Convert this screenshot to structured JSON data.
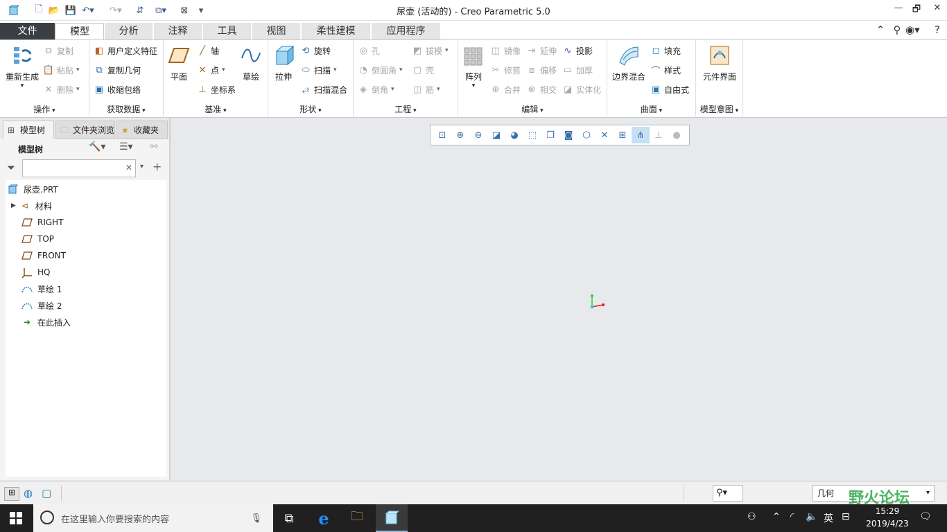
{
  "window": {
    "title": "尿壶 (活动的) - Creo Parametric 5.0",
    "controls": [
      "—",
      "🗗",
      "✕"
    ]
  },
  "tabs": [
    "文件",
    "模型",
    "分析",
    "注释",
    "工具",
    "视图",
    "柔性建模",
    "应用程序"
  ],
  "ribbon": {
    "operations": {
      "label": "操作",
      "regenerate": "重新生成",
      "copy": "复制",
      "paste": "粘贴",
      "delete": "删除"
    },
    "get_data": {
      "label": "获取数据",
      "udf": "用户定义特征",
      "copy_geom": "复制几何",
      "shrinkwrap": "收缩包络"
    },
    "datum": {
      "label": "基准",
      "plane": "平面",
      "axis": "轴",
      "point": "点",
      "csys": "坐标系",
      "sketch": "草绘"
    },
    "shapes": {
      "label": "形状",
      "extrude": "拉伸",
      "revolve": "旋转",
      "sweep": "扫描",
      "swept_blend": "扫描混合"
    },
    "engineering": {
      "label": "工程",
      "hole": "孔",
      "draft": "拔模",
      "round": "倒圆角",
      "shell": "壳",
      "chamfer": "倒角",
      "rib": "筋"
    },
    "editing": {
      "label": "编辑",
      "pattern": "阵列",
      "mirror": "镜像",
      "extend": "延伸",
      "project": "投影",
      "trim": "修剪",
      "offset": "偏移",
      "thicken": "加厚",
      "merge": "合并",
      "intersect": "相交",
      "solidify": "实体化"
    },
    "surfaces": {
      "label": "曲面",
      "boundary_blend": "边界混合",
      "fill": "填充",
      "style": "样式",
      "freestyle": "自由式"
    },
    "model_intent": {
      "label": "模型意图",
      "component_interface": "元件界面"
    }
  },
  "left_panel": {
    "tabs": [
      "模型树",
      "文件夹浏览",
      "收藏夹"
    ],
    "header": "模型树",
    "filter_value": "",
    "tree": [
      {
        "label": "尿壶.PRT",
        "icon": "part-icon"
      },
      {
        "label": "材料",
        "icon": "material-icon"
      },
      {
        "label": "RIGHT",
        "icon": "datum-plane-icon"
      },
      {
        "label": "TOP",
        "icon": "datum-plane-icon"
      },
      {
        "label": "FRONT",
        "icon": "datum-plane-icon"
      },
      {
        "label": "HQ",
        "icon": "csys-icon"
      },
      {
        "label": "草绘 1",
        "icon": "sketch-icon"
      },
      {
        "label": "草绘 2",
        "icon": "sketch-icon"
      },
      {
        "label": "在此插入",
        "icon": "insert-here-icon"
      }
    ]
  },
  "status": {
    "filter_value": "几何"
  },
  "taskbar": {
    "search_placeholder": "在这里输入你要搜索的内容",
    "ime": "英",
    "time": "15:29",
    "date": "2019/4/23",
    "watermark": "野火论坛"
  },
  "colors": {
    "accent": "#3b3f44",
    "selection": "#c7dff5",
    "graphics_bg": "#e8e9ec"
  }
}
